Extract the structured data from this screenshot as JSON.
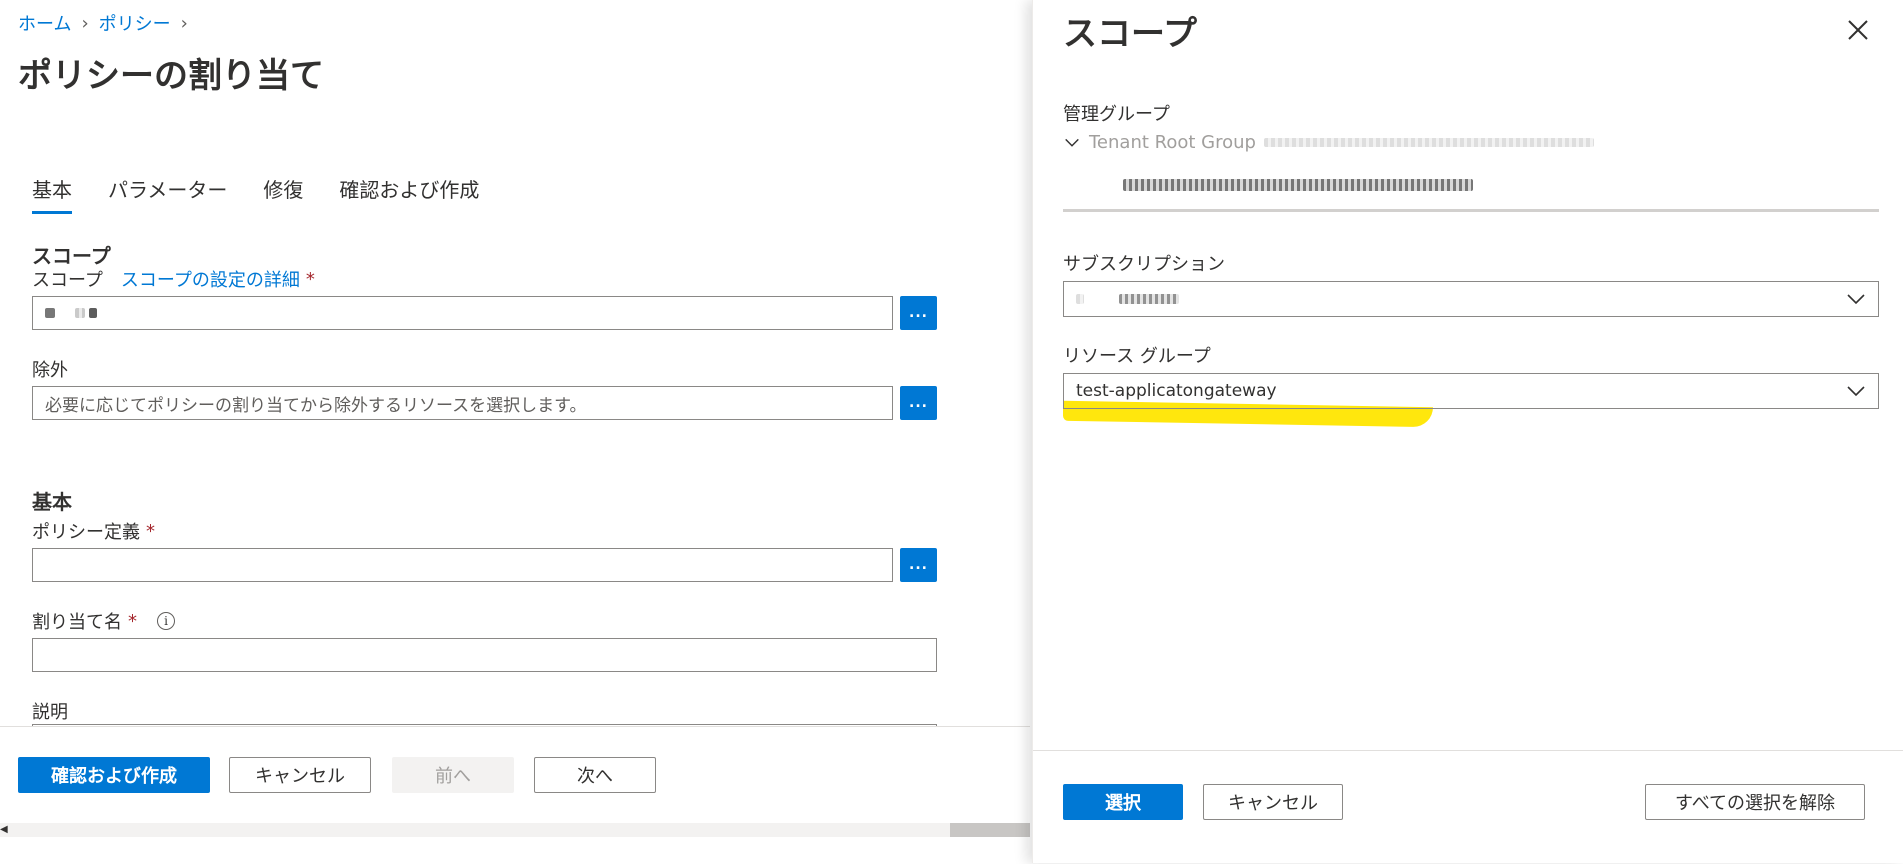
{
  "breadcrumb": {
    "items": [
      "ホーム",
      "ポリシー"
    ]
  },
  "page": {
    "title": "ポリシーの割り当て"
  },
  "tabs": [
    "基本",
    "パラメーター",
    "修復",
    "確認および作成"
  ],
  "scope_section": {
    "heading": "スコープ",
    "label": "スコープ",
    "link": "スコープの設定の詳細",
    "required": "*"
  },
  "exclusion": {
    "label": "除外",
    "placeholder": "必要に応じてポリシーの割り当てから除外するリソースを選択します。"
  },
  "basics_section": {
    "heading": "基本",
    "policy_label": "ポリシー定義",
    "assignment_label": "割り当て名",
    "info_icon": "i",
    "description_label": "説明",
    "required": "*"
  },
  "ellipsis_label": "...",
  "footer": {
    "review_create": "確認および作成",
    "cancel": "キャンセル",
    "prev": "前へ",
    "next": "次へ"
  },
  "panel": {
    "title": "スコープ",
    "management_group_label": "管理グループ",
    "tenant_root": "Tenant Root Group",
    "subscription_label": "サブスクリプション",
    "resource_group_label": "リソース グループ",
    "resource_group_value": "test-applicatongateway",
    "highlight_color": "#ffe600",
    "select_button": "選択",
    "cancel_button": "キャンセル",
    "clear_button": "すべての選択を解除"
  },
  "colors": {
    "accent": "#0078d4",
    "required": "#a4262c"
  }
}
